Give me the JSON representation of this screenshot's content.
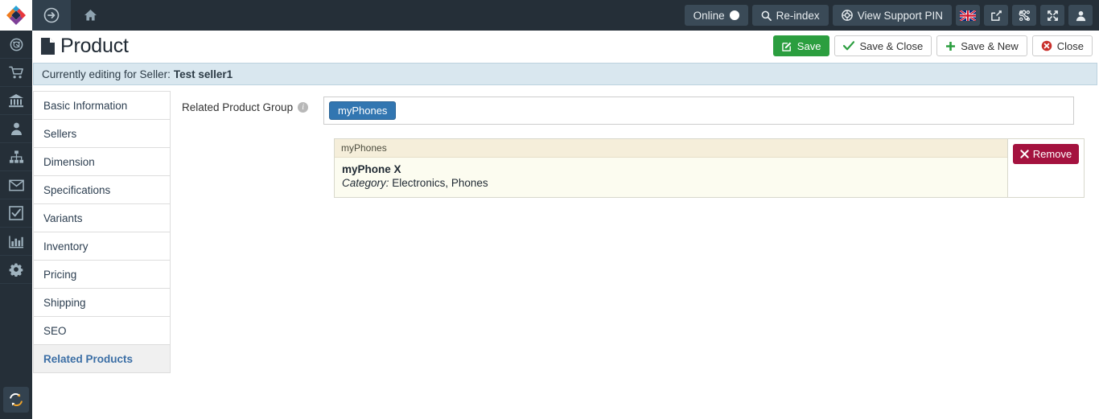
{
  "topbar": {
    "logo_icon": "brand-diamond-logo",
    "nav_arrow_icon": "arrow-circle-right-icon",
    "home_icon": "home-icon",
    "online_label": "Online",
    "reindex_label": "Re-index",
    "reindex_icon": "search-icon",
    "support_pin_label": "View Support PIN",
    "support_pin_icon": "lifering-icon",
    "flag_icon": "uk-flag-icon",
    "external_link_icon": "external-link-icon",
    "joomla_icon": "joomla-logo-icon",
    "fullscreen_icon": "expand-arrows-icon",
    "user_icon": "user-icon"
  },
  "rail": {
    "items": [
      {
        "icon": "dashboard-gauge-icon"
      },
      {
        "icon": "shopping-cart-icon"
      },
      {
        "icon": "bank-institution-icon"
      },
      {
        "icon": "user-icon"
      },
      {
        "icon": "sitemap-icon"
      },
      {
        "icon": "envelope-icon"
      },
      {
        "icon": "checkbox-checked-icon"
      },
      {
        "icon": "bar-chart-icon"
      },
      {
        "icon": "gear-icon"
      }
    ],
    "bottom_icon": "refresh-sync-icon"
  },
  "header": {
    "title": "Product",
    "title_icon": "file-page-icon",
    "actions": [
      {
        "label": "Save",
        "icon": "save-pencil-icon",
        "style": "primary"
      },
      {
        "label": "Save & Close",
        "icon": "check-icon",
        "style": "default"
      },
      {
        "label": "Save & New",
        "icon": "plus-icon",
        "style": "default"
      },
      {
        "label": "Close",
        "icon": "close-circle-icon",
        "style": "default"
      }
    ]
  },
  "banner": {
    "prefix": "Currently editing for Seller:",
    "seller": "Test seller1"
  },
  "tabs": [
    {
      "label": "Basic Information",
      "active": false
    },
    {
      "label": "Sellers",
      "active": false
    },
    {
      "label": "Dimension",
      "active": false
    },
    {
      "label": "Specifications",
      "active": false
    },
    {
      "label": "Variants",
      "active": false
    },
    {
      "label": "Inventory",
      "active": false
    },
    {
      "label": "Pricing",
      "active": false
    },
    {
      "label": "Shipping",
      "active": false
    },
    {
      "label": "SEO",
      "active": false
    },
    {
      "label": "Related Products",
      "active": true
    }
  ],
  "main": {
    "field_label": "Related Product Group",
    "info_icon": "info-circle-icon",
    "chips": [
      {
        "label": "myPhones"
      }
    ],
    "group": {
      "header": "myPhones",
      "product_name": "myPhone X",
      "category_label": "Category:",
      "category_value": "Electronics, Phones",
      "remove_label": "Remove",
      "remove_icon": "times-icon"
    }
  },
  "colors": {
    "topbar_bg": "#252f38",
    "accent_blue": "#3276b1",
    "save_green": "#2b9e3f",
    "remove_red": "#a4123f",
    "banner_blue": "#d9e7ef",
    "card_cream": "#fcfcf0",
    "card_head": "#f5eeda"
  }
}
